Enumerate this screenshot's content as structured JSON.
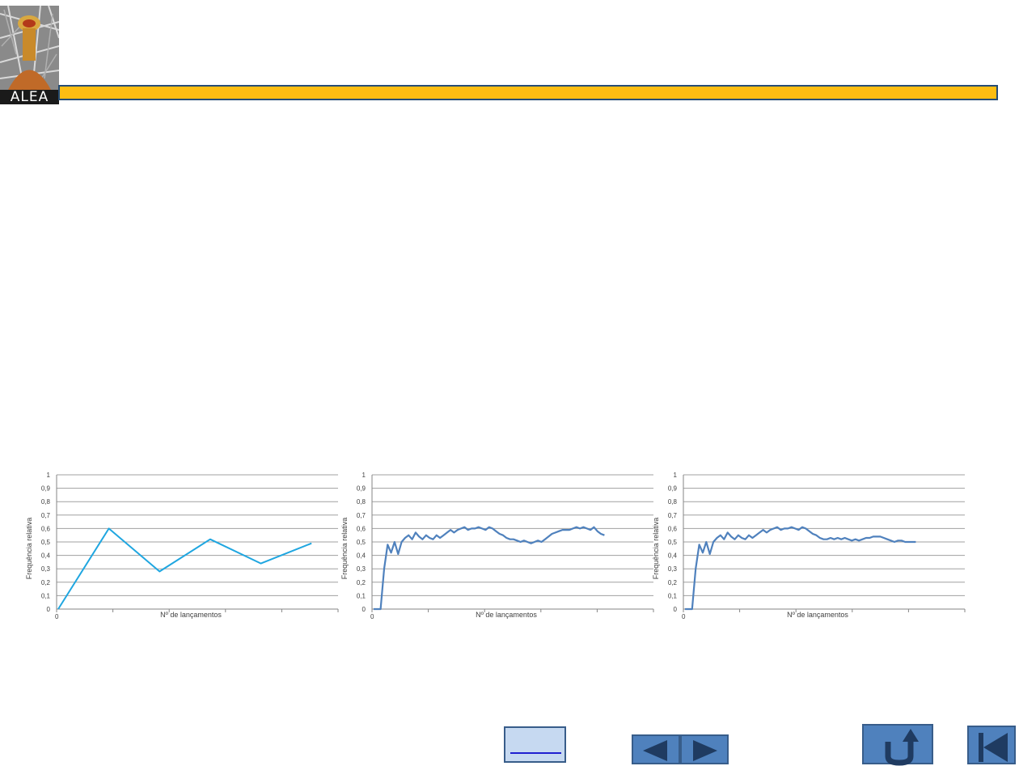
{
  "logo": {
    "text": "ALEA"
  },
  "charts": [
    {
      "type": "line",
      "ylabel": "Frequência relativa",
      "xlabel": "Nº de lançamentos",
      "x_tick_label": "0",
      "y_ticks": [
        "0",
        "0,1",
        "0,2",
        "0,3",
        "0,4",
        "0,5",
        "0,6",
        "0,7",
        "0,8",
        "0,9",
        "1"
      ],
      "line_color": "#1fa6e0",
      "x_categories": 5,
      "values": [
        0,
        0.6,
        0.28,
        0.52,
        0.34,
        0.49
      ]
    },
    {
      "type": "line",
      "ylabel": "Frequência relativa",
      "xlabel": "Nº de lançamentos",
      "x_tick_label": "0",
      "y_ticks": [
        "0",
        "0,1",
        "0,2",
        "0,3",
        "0,4",
        "0,5",
        "0,6",
        "0,7",
        "0,8",
        "0,9",
        "1"
      ],
      "line_color": "#4f81bd",
      "x_categories": 5,
      "values": [
        0,
        0,
        0,
        0.3,
        0.48,
        0.42,
        0.5,
        0.41,
        0.5,
        0.53,
        0.55,
        0.52,
        0.57,
        0.54,
        0.52,
        0.55,
        0.53,
        0.52,
        0.55,
        0.53,
        0.55,
        0.57,
        0.59,
        0.57,
        0.59,
        0.6,
        0.61,
        0.59,
        0.6,
        0.6,
        0.61,
        0.6,
        0.59,
        0.61,
        0.6,
        0.58,
        0.56,
        0.55,
        0.53,
        0.52,
        0.52,
        0.51,
        0.5,
        0.51,
        0.5,
        0.49,
        0.5,
        0.51,
        0.5,
        0.52,
        0.54,
        0.56,
        0.57,
        0.58,
        0.59,
        0.59,
        0.59,
        0.6,
        0.61,
        0.6,
        0.61,
        0.6,
        0.59,
        0.61,
        0.58,
        0.56,
        0.55
      ]
    },
    {
      "type": "line",
      "ylabel": "Frequência relativa",
      "xlabel": "Nº de lançamentos",
      "x_tick_label": "0",
      "y_ticks": [
        "0",
        "0,1",
        "0,2",
        "0,3",
        "0,4",
        "0,5",
        "0,6",
        "0,7",
        "0,8",
        "0,9",
        "1"
      ],
      "line_color": "#4f81bd",
      "x_categories": 5,
      "values": [
        0,
        0,
        0,
        0.3,
        0.48,
        0.42,
        0.5,
        0.41,
        0.5,
        0.53,
        0.55,
        0.52,
        0.57,
        0.54,
        0.52,
        0.55,
        0.53,
        0.52,
        0.55,
        0.53,
        0.55,
        0.57,
        0.59,
        0.57,
        0.59,
        0.6,
        0.61,
        0.59,
        0.6,
        0.6,
        0.61,
        0.6,
        0.59,
        0.61,
        0.6,
        0.58,
        0.56,
        0.55,
        0.53,
        0.52,
        0.52,
        0.53,
        0.52,
        0.53,
        0.52,
        0.53,
        0.52,
        0.51,
        0.52,
        0.51,
        0.52,
        0.53,
        0.53,
        0.54,
        0.54,
        0.54,
        0.53,
        0.52,
        0.51,
        0.5,
        0.51,
        0.51,
        0.5,
        0.5,
        0.5,
        0.5
      ]
    }
  ],
  "nav": {
    "blank_label": "",
    "prev_icon": "triangle-left-icon",
    "next_icon": "triangle-right-icon",
    "return_icon": "u-turn-arrow-icon",
    "first_icon": "skip-to-start-icon"
  }
}
